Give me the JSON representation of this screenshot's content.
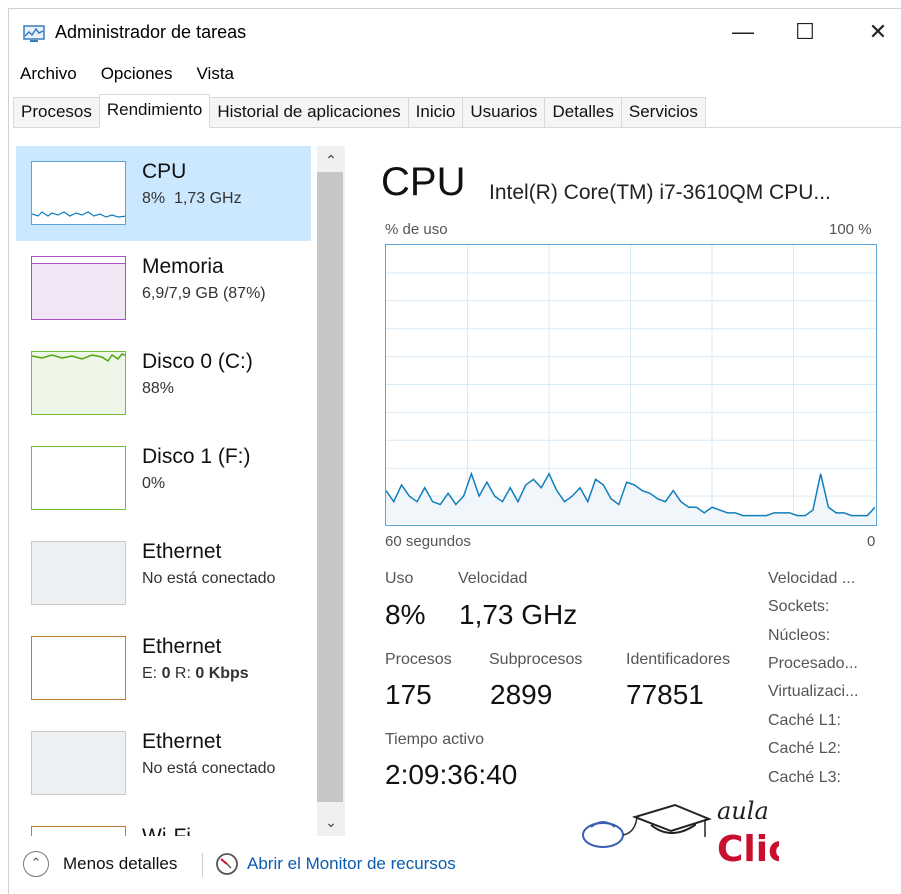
{
  "window": {
    "title": "Administrador de tareas",
    "minimize": "—",
    "maximize": "☐",
    "close": "✕"
  },
  "menu": [
    "Archivo",
    "Opciones",
    "Vista"
  ],
  "tabs": [
    "Procesos",
    "Rendimiento",
    "Historial de aplicaciones",
    "Inicio",
    "Usuarios",
    "Detalles",
    "Servicios"
  ],
  "active_tab": "Rendimiento",
  "resources": [
    {
      "name": "CPU",
      "value": "8%  1,73 GHz",
      "color": "#117dbb"
    },
    {
      "name": "Memoria",
      "value": "6,9/7,9 GB (87%)",
      "color": "#8b12ae"
    },
    {
      "name": "Disco 0 (C:)",
      "value": "88%",
      "color": "#4da60c"
    },
    {
      "name": "Disco 1 (F:)",
      "value": "0%",
      "color": "#4da60c"
    },
    {
      "name": "Ethernet",
      "value": "No está conectado",
      "color": "#a7a7a7"
    },
    {
      "name": "Ethernet",
      "value_parts": [
        "E: ",
        "0",
        " R: ",
        "0 Kbps"
      ],
      "color": "#a74f01"
    },
    {
      "name": "Ethernet",
      "value": "No está conectado",
      "color": "#a7a7a7"
    },
    {
      "name": "Wi-Fi",
      "value": "",
      "color": "#a74f01"
    }
  ],
  "detail": {
    "title": "CPU",
    "model": "Intel(R) Core(TM) i7-3610QM CPU...",
    "usage_label": "% de uso",
    "max_label": "100 %",
    "time_label": "60 segundos",
    "min_label": "0",
    "stats": {
      "uso_label": "Uso",
      "uso": "8%",
      "velocidad_label": "Velocidad",
      "velocidad": "1,73 GHz",
      "procesos_label": "Procesos",
      "procesos": "175",
      "subprocesos_label": "Subprocesos",
      "subprocesos": "2899",
      "identificadores_label": "Identificadores",
      "identificadores": "77851",
      "tiempo_label": "Tiempo activo",
      "tiempo": "2:09:36:40"
    },
    "specs": [
      "Velocidad ...",
      "Sockets:",
      "Núcleos:",
      "Procesado...",
      "Virtualizaci...",
      "Caché L1:",
      "Caché L2:",
      "Caché L3:"
    ]
  },
  "cpu_history": [
    12,
    8,
    14,
    10,
    8,
    13,
    8,
    7,
    11,
    7,
    10,
    18,
    10,
    15,
    10,
    8,
    13,
    8,
    14,
    16,
    13,
    18,
    12,
    8,
    10,
    13,
    8,
    16,
    14,
    9,
    7,
    15,
    14,
    12,
    11,
    9,
    8,
    12,
    8,
    6,
    6,
    4,
    6,
    5,
    4,
    4,
    3,
    3,
    3,
    3,
    4,
    4,
    4,
    3,
    3,
    5,
    18,
    6,
    4,
    4,
    3,
    3,
    3,
    6
  ],
  "footer": {
    "less_details": "Menos detalles",
    "monitor_link": "Abrir el Monitor de recursos"
  },
  "logo": {
    "line1": "aula",
    "line2": "Clic"
  },
  "colors": {
    "cpu_line": "#117dbb",
    "selected_bg": "#cce8ff",
    "link": "#0b5cad"
  }
}
